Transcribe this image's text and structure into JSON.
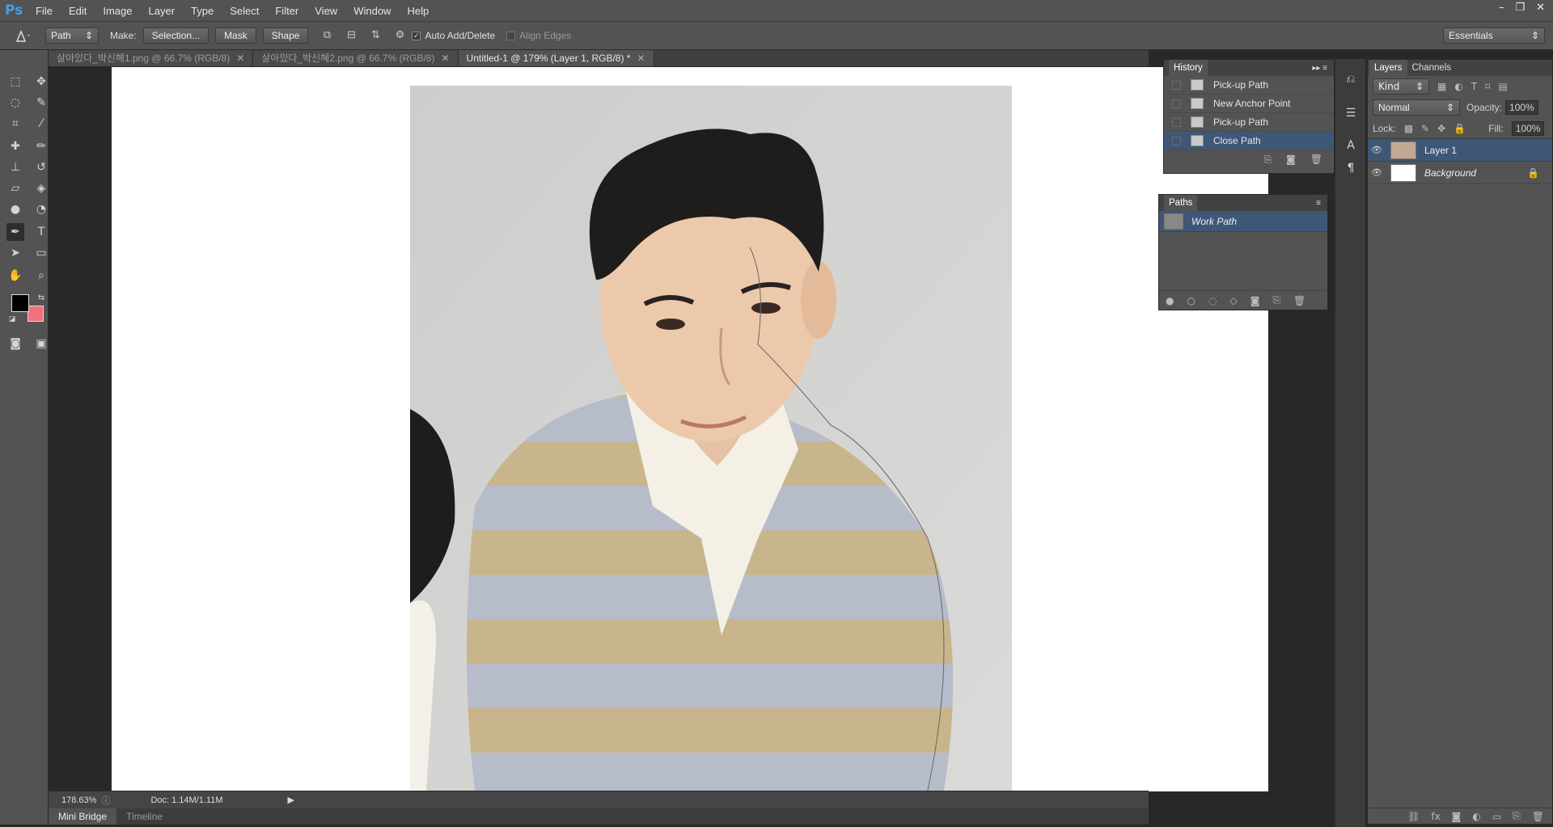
{
  "app": {
    "logo": "Ps"
  },
  "menu": [
    "File",
    "Edit",
    "Image",
    "Layer",
    "Type",
    "Select",
    "Filter",
    "View",
    "Window",
    "Help"
  ],
  "window_controls": {
    "minimize": "–",
    "restore": "❐",
    "close": "✕"
  },
  "options": {
    "tool_mode": "Path",
    "make_label": "Make:",
    "selection_btn": "Selection...",
    "mask_btn": "Mask",
    "shape_btn": "Shape",
    "auto_add_delete": "Auto Add/Delete",
    "auto_add_checked": true,
    "align_edges": "Align Edges",
    "workspace": "Essentials"
  },
  "tabs": [
    {
      "label": "살아있다_박신혜1.png @ 66.7% (RGB/8)",
      "active": false
    },
    {
      "label": "살아있다_박신혜2.png @ 66.7% (RGB/8)",
      "active": false
    },
    {
      "label": "Untitled-1 @ 179% (Layer 1, RGB/8) *",
      "active": true
    }
  ],
  "status": {
    "zoom": "178.63%",
    "doc": "Doc: 1.14M/1.11M"
  },
  "bottom_tabs": [
    "Mini Bridge",
    "Timeline"
  ],
  "history": {
    "title": "History",
    "items": [
      {
        "label": "Pick-up Path",
        "selected": false
      },
      {
        "label": "New Anchor Point",
        "selected": false
      },
      {
        "label": "Pick-up Path",
        "selected": false
      },
      {
        "label": "Close Path",
        "selected": true
      }
    ]
  },
  "paths": {
    "title": "Paths",
    "items": [
      {
        "label": "Work Path",
        "selected": true
      }
    ]
  },
  "layers_panel": {
    "tab_layers": "Layers",
    "tab_channels": "Channels",
    "kind": "Kind",
    "blend_mode": "Normal",
    "opacity_label": "Opacity:",
    "opacity": "100%",
    "lock_label": "Lock:",
    "fill_label": "Fill:",
    "fill": "100%",
    "layers": [
      {
        "name": "Layer 1",
        "selected": true,
        "italic": false
      },
      {
        "name": "Background",
        "selected": false,
        "italic": true
      }
    ]
  },
  "colors": {
    "foreground": "#000000",
    "background": "#f1707a",
    "selection": "#3e5777"
  }
}
